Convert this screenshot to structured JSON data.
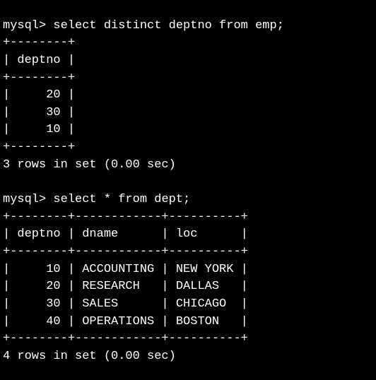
{
  "query1": {
    "prompt": "mysql>",
    "sql": " select distinct deptno from emp;",
    "border_top": "+--------+",
    "header": "| deptno |",
    "border_mid": "+--------+",
    "rows": [
      "|     20 |",
      "|     30 |",
      "|     10 |"
    ],
    "border_bot": "+--------+",
    "status": "3 rows in set (0.00 sec)"
  },
  "blank": " ",
  "query2": {
    "prompt": "mysql>",
    "sql": " select * from dept;",
    "border_top": "+--------+------------+----------+",
    "header": "| deptno | dname      | loc      |",
    "border_mid": "+--------+------------+----------+",
    "rows": [
      "|     10 | ACCOUNTING | NEW YORK |",
      "|     20 | RESEARCH   | DALLAS   |",
      "|     30 | SALES      | CHICAGO  |",
      "|     40 | OPERATIONS | BOSTON   |"
    ],
    "border_bot": "+--------+------------+----------+",
    "status": "4 rows in set (0.00 sec)"
  },
  "chart_data": [
    {
      "type": "table",
      "title": "select distinct deptno from emp",
      "columns": [
        "deptno"
      ],
      "rows": [
        [
          20
        ],
        [
          30
        ],
        [
          10
        ]
      ]
    },
    {
      "type": "table",
      "title": "select * from dept",
      "columns": [
        "deptno",
        "dname",
        "loc"
      ],
      "rows": [
        [
          10,
          "ACCOUNTING",
          "NEW YORK"
        ],
        [
          20,
          "RESEARCH",
          "DALLAS"
        ],
        [
          30,
          "SALES",
          "CHICAGO"
        ],
        [
          40,
          "OPERATIONS",
          "BOSTON"
        ]
      ]
    }
  ]
}
